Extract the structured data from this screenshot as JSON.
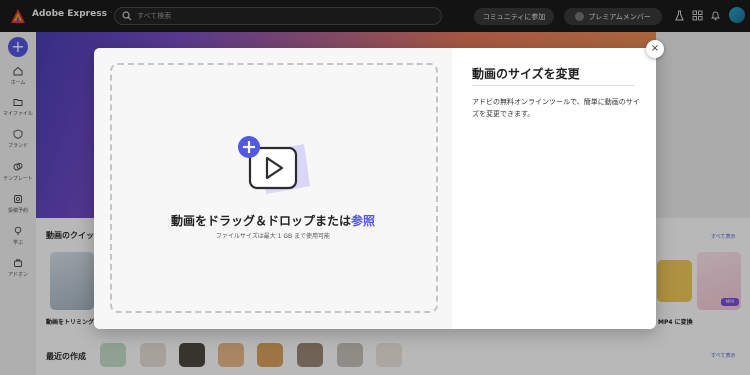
{
  "app": {
    "title": "Adobe Express"
  },
  "search": {
    "placeholder": "すべて検索"
  },
  "header": {
    "community_label": "コミュニティに参加",
    "premium_label": "プレミアムメンバー"
  },
  "sidebar": {
    "create_label": "+",
    "items": [
      {
        "label": "ホーム",
        "icon": "home-icon"
      },
      {
        "label": "マイファイル",
        "icon": "folder-icon"
      },
      {
        "label": "ブランド",
        "icon": "brand-icon"
      },
      {
        "label": "テンプレート",
        "icon": "template-icon"
      },
      {
        "label": "投稿予約",
        "icon": "schedule-icon"
      },
      {
        "label": "学ぶ",
        "icon": "learn-icon"
      },
      {
        "label": "アドオン",
        "icon": "addon-icon"
      }
    ]
  },
  "background": {
    "quick_actions_title": "動画のクイッ",
    "see_all_1": "すべて表示",
    "caption_trim": "動画をトリミング",
    "caption_mp4": "MP4 に変換",
    "mp4_badge": "MP4",
    "recent_title": "最近の作成",
    "see_all_2": "すべて表示"
  },
  "modal": {
    "drop_title": "動画をドラッグ＆ドロップまたは",
    "drop_link": "参照",
    "drop_note": "ファイルサイズは最大 1 GB まで使用可能",
    "title": "動画のサイズを変更",
    "description": "アドビの無料オンラインツールで、簡単に動画のサイズを変更できます。",
    "close_label": "×"
  },
  "colors": {
    "accent": "#5258e4",
    "topbar": "#1b1b1b"
  }
}
